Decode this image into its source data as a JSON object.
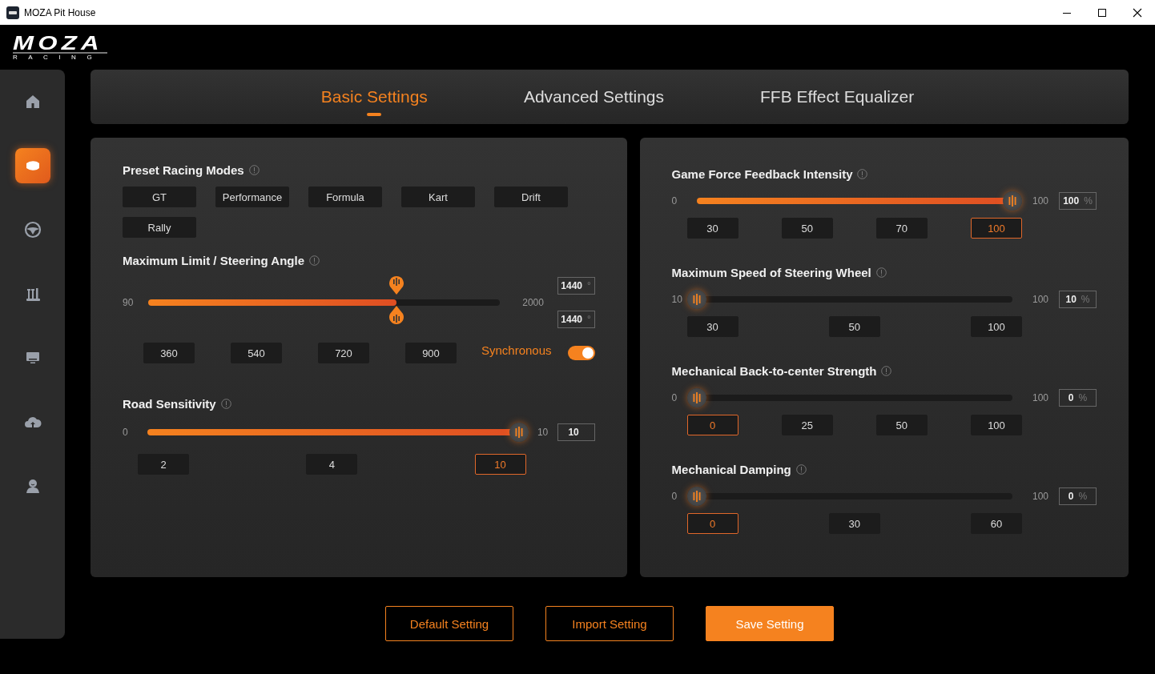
{
  "window": {
    "title": "MOZA Pit House"
  },
  "logo": {
    "brand": "MOZA",
    "subtitle": "RACING"
  },
  "sidebar": {
    "items": [
      {
        "kind": "home",
        "selected": false
      },
      {
        "kind": "wheelbase",
        "selected": true
      },
      {
        "kind": "wheel",
        "selected": false
      },
      {
        "kind": "pedals",
        "selected": false
      },
      {
        "kind": "display",
        "selected": false
      },
      {
        "kind": "cloud",
        "selected": false
      },
      {
        "kind": "user",
        "selected": false
      }
    ]
  },
  "tabs": [
    {
      "label": "Basic Settings",
      "selected": true
    },
    {
      "label": "Advanced Settings",
      "selected": false
    },
    {
      "label": "FFB Effect Equalizer",
      "selected": false
    }
  ],
  "presets": {
    "title": "Preset Racing Modes",
    "options": [
      "GT",
      "Performance",
      "Formula",
      "Kart",
      "Drift",
      "Rally"
    ]
  },
  "steering": {
    "title": "Maximum Limit / Steering Angle",
    "min": "90",
    "max": "2000",
    "level": 0.707,
    "fields": [
      {
        "value": "1440",
        "unit": "°"
      },
      {
        "value": "1440",
        "unit": "°"
      }
    ],
    "options": [
      "360",
      "540",
      "720",
      "900"
    ],
    "sync": {
      "label": "Synchronous",
      "on": true
    }
  },
  "road": {
    "title": "Road Sensitivity",
    "min": "0",
    "max": "10",
    "level": 1,
    "value": "10",
    "options": [
      {
        "label": "2",
        "selected": false
      },
      {
        "label": "4",
        "selected": false
      },
      {
        "label": "10",
        "selected": true
      }
    ]
  },
  "sliders": [
    {
      "title": "Game Force Feedback Intensity",
      "min": "0",
      "max": "100",
      "level": 1,
      "value": "100",
      "unit": "%",
      "options": [
        {
          "label": "30",
          "selected": false
        },
        {
          "label": "50",
          "selected": false
        },
        {
          "label": "70",
          "selected": false
        },
        {
          "label": "100",
          "selected": true
        }
      ]
    },
    {
      "title": "Maximum Speed of Steering Wheel",
      "min": "10",
      "max": "100",
      "level": 0,
      "value": "10",
      "unit": "%",
      "options": [
        {
          "label": "30",
          "selected": false
        },
        {
          "label": "50",
          "selected": false
        },
        {
          "label": "100",
          "selected": false
        }
      ]
    },
    {
      "title": "Mechanical Back-to-center Strength",
      "min": "0",
      "max": "100",
      "level": 0,
      "value": "0",
      "unit": "%",
      "options": [
        {
          "label": "0",
          "selected": true
        },
        {
          "label": "25",
          "selected": false
        },
        {
          "label": "50",
          "selected": false
        },
        {
          "label": "100",
          "selected": false
        }
      ]
    },
    {
      "title": "Mechanical Damping",
      "min": "0",
      "max": "100",
      "level": 0,
      "value": "0",
      "unit": "%",
      "options": [
        {
          "label": "0",
          "selected": true
        },
        {
          "label": "30",
          "selected": false
        },
        {
          "label": "60",
          "selected": false
        }
      ]
    }
  ],
  "buttons": [
    {
      "label": "Default Setting",
      "kind": "outline"
    },
    {
      "label": "Import Setting",
      "kind": "outline"
    },
    {
      "label": "Save Setting",
      "kind": "primary"
    }
  ]
}
